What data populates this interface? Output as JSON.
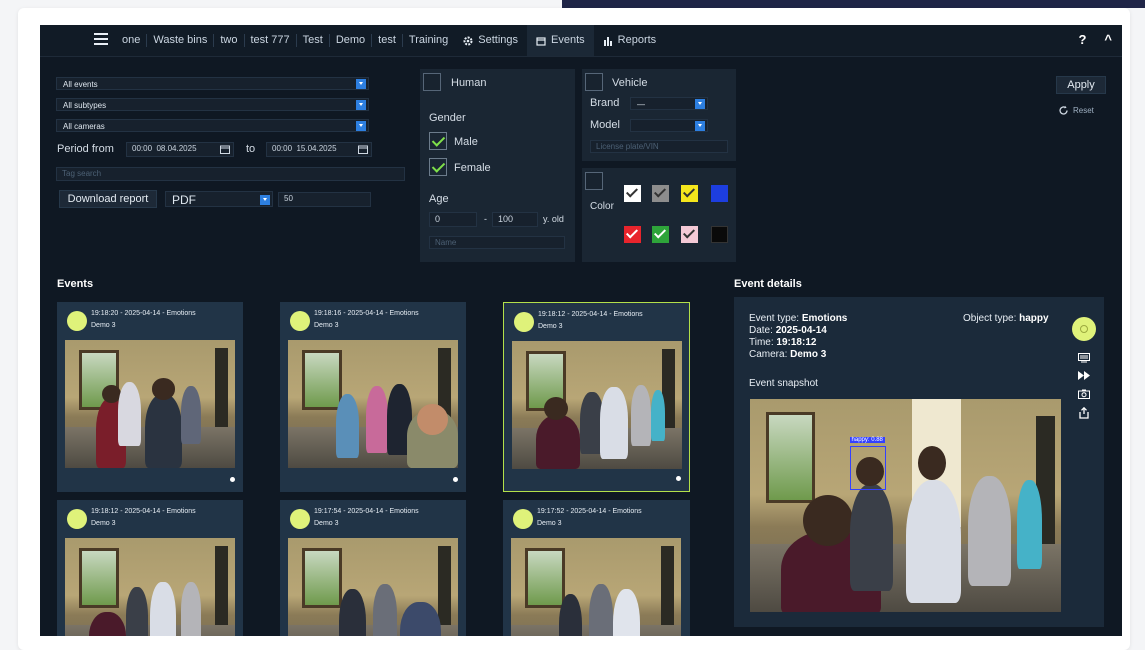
{
  "nav": {
    "tabs": [
      "one",
      "Waste bins",
      "two",
      "test 777",
      "Test",
      "Demo",
      "test",
      "Training"
    ],
    "settings": "Settings",
    "events": "Events",
    "reports": "Reports",
    "help": "?",
    "collapse": "^"
  },
  "filters": {
    "event_type": "All events",
    "subtype": "All subtypes",
    "cameras": "All cameras",
    "period_label": "Period from",
    "from_time": "00:00",
    "from_date": "08.04.2025",
    "to_label": "to",
    "to_time": "00:00",
    "to_date": "15.04.2025",
    "tag_search_placeholder": "Tag search",
    "download_report": "Download report",
    "format": "PDF",
    "count": "50"
  },
  "human": {
    "label": "Human",
    "gender_label": "Gender",
    "male": "Male",
    "female": "Female",
    "age_label": "Age",
    "age_from": "0",
    "age_sep": "-",
    "age_to": "100",
    "age_unit": "y. old",
    "name_placeholder": "Name"
  },
  "vehicle": {
    "label": "Vehicle",
    "brand_label": "Brand",
    "brand_value": "—",
    "model_label": "Model",
    "model_value": "",
    "plate_placeholder": "License plate/VIN"
  },
  "color": {
    "label": "Color",
    "swatches": [
      "#ffffff",
      "#8d8d8d",
      "#f5e61c",
      "#1d3ee0",
      "#e8242c",
      "#2ea43a",
      "#f4c9d6",
      "#0a0a0a"
    ]
  },
  "actions": {
    "apply": "Apply",
    "reset": "Reset"
  },
  "events_title": "Events",
  "events": [
    {
      "title": "19:18:20 - 2025-04-14 - Emotions",
      "camera": "Demo 3"
    },
    {
      "title": "19:18:16 - 2025-04-14 - Emotions",
      "camera": "Demo 3"
    },
    {
      "title": "19:18:12 - 2025-04-14 - Emotions",
      "camera": "Demo 3"
    },
    {
      "title": "19:18:12 - 2025-04-14 - Emotions",
      "camera": "Demo 3"
    },
    {
      "title": "19:17:54 - 2025-04-14 - Emotions",
      "camera": "Demo 3"
    },
    {
      "title": "19:17:52 - 2025-04-14 - Emotions",
      "camera": "Demo 3"
    }
  ],
  "details": {
    "title": "Event details",
    "event_type_label": "Event type:",
    "event_type": "Emotions",
    "date_label": "Date:",
    "date": "2025-04-14",
    "time_label": "Time:",
    "time": "19:18:12",
    "camera_label": "Camera:",
    "camera": "Demo 3",
    "object_type_label": "Object type:",
    "object_type": "happy",
    "snapshot_label": "Event snapshot",
    "detection_label": "happy: 0.88"
  }
}
